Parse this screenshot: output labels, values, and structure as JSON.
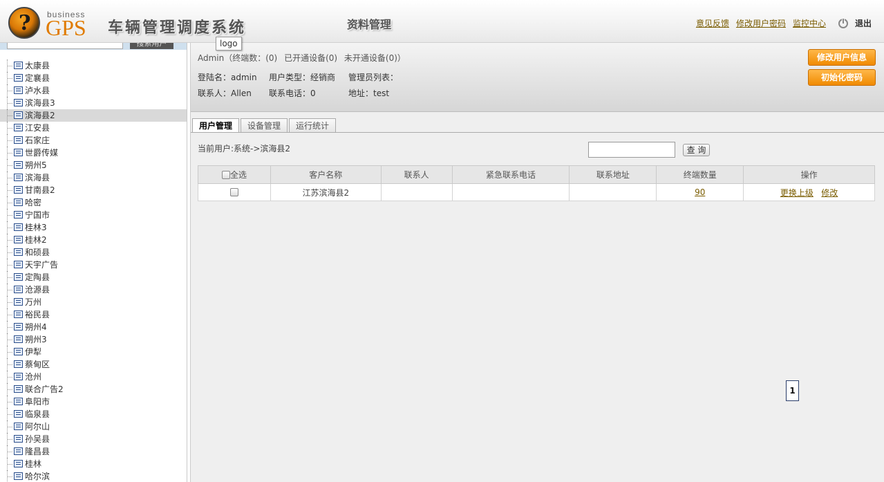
{
  "header": {
    "logo_small": "business",
    "logo_big": "GPS",
    "system_title": "车辆管理调度系统",
    "module_title": "资料管理",
    "links": [
      "意见反馈",
      "修改用户密码",
      "监控中心"
    ],
    "logout": "退出"
  },
  "tooltip": "logo",
  "sidebar": {
    "search_button": "搜索用户",
    "items": [
      "太康县",
      "定襄县",
      "泸水县",
      "滨海县3",
      "滨海县2",
      "江安县",
      "石家庄",
      "世爵传媒",
      "朔州5",
      "滨海县",
      "甘南县2",
      "哈密",
      "宁国市",
      "桂林3",
      "桂林2",
      "和硕县",
      "天宇广告",
      "定陶县",
      "沧源县",
      "万州",
      "裕民县",
      "朔州4",
      "朔州3",
      "伊犁",
      "蔡甸区",
      "沧州",
      "联合广告2",
      "阜阳市",
      "临泉县",
      "阿尔山",
      "孙吴县",
      "隆昌县",
      "桂林",
      "哈尔滨"
    ],
    "selected_index": 4
  },
  "info": {
    "summary": [
      "Admin（终端数：(0)",
      "已开通设备(0)",
      "未开通设备(0)）"
    ],
    "login_label": "登陆名：admin",
    "user_type": "用户类型：经销商",
    "admin_list": "管理员列表：",
    "contact": "联系人：Allen",
    "phone": "联系电话：0",
    "address": "地址：test",
    "btn_edit": "修改用户信息",
    "btn_reset": "初始化密码"
  },
  "tabs": [
    "用户管理",
    "设备管理",
    "运行统计"
  ],
  "breadcrumb": "当前用户:系统->滨海县2",
  "search": {
    "value": "",
    "button": "查 询"
  },
  "table": {
    "headers": [
      "全选",
      "客户名称",
      "联系人",
      "紧急联系电话",
      "联系地址",
      "终端数量",
      "操作"
    ],
    "rows": [
      {
        "name": "江苏滨海县2",
        "contact": "",
        "phone": "",
        "address": "",
        "count": "90",
        "action1": "更换上级",
        "action2": "修改"
      }
    ]
  },
  "pager": {
    "current": "1"
  }
}
